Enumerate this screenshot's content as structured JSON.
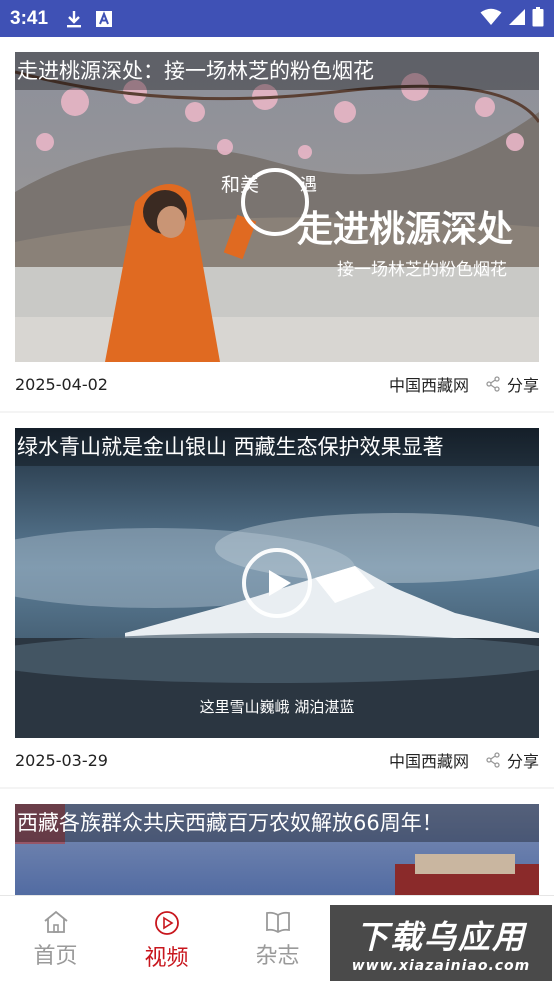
{
  "status_bar": {
    "time": "3:41",
    "icons": [
      "download-icon",
      "font-a-icon",
      "wifi-icon",
      "signal-icon",
      "battery-icon"
    ]
  },
  "feed": {
    "items": [
      {
        "title": "走进桃源深处：接一场林芝的粉色烟花",
        "thumb_caption_small": "和美",
        "thumb_caption_small2": "遇",
        "thumb_caption_big": "走进桃源深处",
        "thumb_caption_sub": "接一场林芝的粉色烟花",
        "date": "2025-04-02",
        "source": "中国西藏网",
        "share_label": "分享"
      },
      {
        "title": "绿水青山就是金山银山 西藏生态保护效果显著",
        "thumb_caption": "这里雪山巍峨 湖泊湛蓝",
        "date": "2025-03-29",
        "source": "中国西藏网",
        "share_label": "分享"
      },
      {
        "title": "西藏各族群众共庆西藏百万农奴解放66周年！"
      }
    ]
  },
  "tabbar": {
    "tabs": [
      {
        "label": "首页",
        "icon": "home-icon",
        "active": false
      },
      {
        "label": "视频",
        "icon": "play-circle-icon",
        "active": true
      },
      {
        "label": "杂志",
        "icon": "book-icon",
        "active": false
      }
    ]
  },
  "watermark": {
    "main": "下载乌应用",
    "url": "www.xiazainiao.com"
  },
  "colors": {
    "status_bar": "#3f51b5",
    "accent": "#c8161d",
    "inactive": "#9a9a9a"
  }
}
